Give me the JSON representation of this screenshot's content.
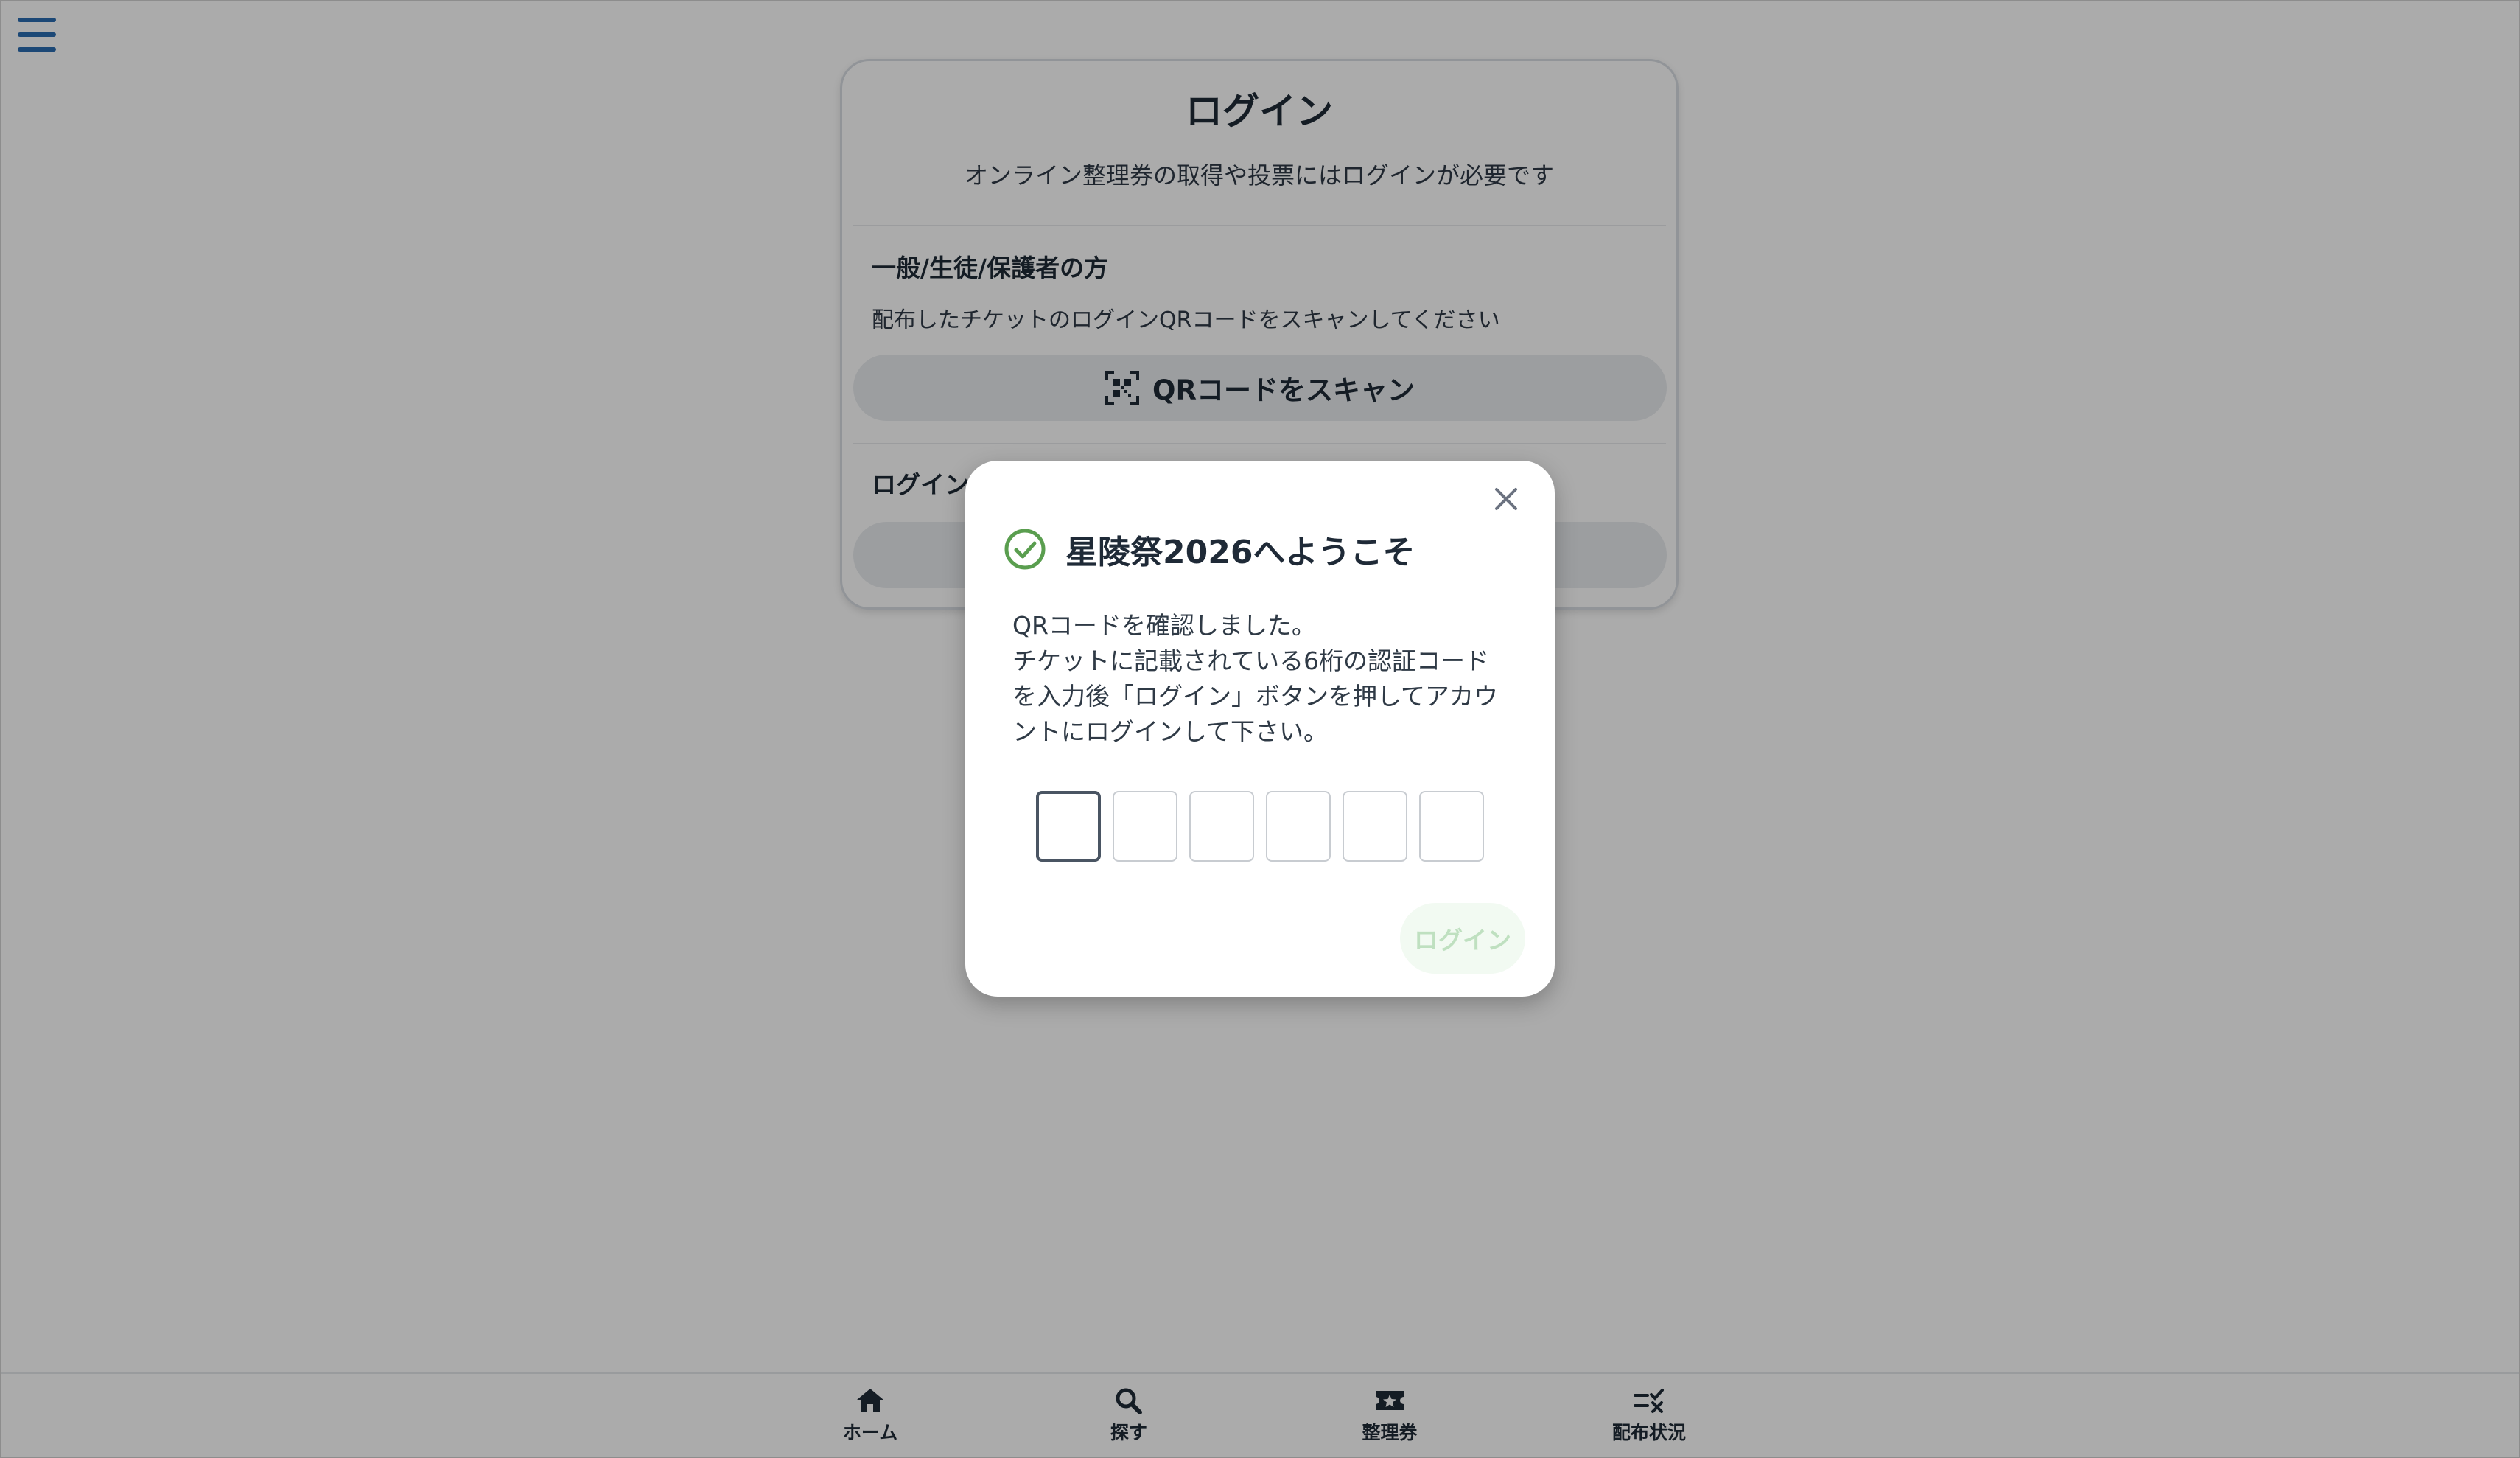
{
  "page": {
    "title": "ログイン",
    "subtitle": "オンライン整理券の取得や投票にはログインが必要です"
  },
  "general_section": {
    "heading": "一般/生徒/保護者の方",
    "description": "配布したチケットのログインQRコードをスキャンしてください",
    "scan_button_label": "QRコードをスキャン",
    "scan_icon": "qr-scan-icon"
  },
  "other_section": {
    "heading_visible": "ログイン"
  },
  "nav": {
    "items": [
      {
        "label": "ホーム",
        "icon": "home-icon"
      },
      {
        "label": "探す",
        "icon": "search-icon"
      },
      {
        "label": "整理券",
        "icon": "ticket-icon"
      },
      {
        "label": "配布状況",
        "icon": "checklist-icon"
      }
    ]
  },
  "dialog": {
    "title": "星陵祭2026へようこそ",
    "icon": "check-circle-icon",
    "message_lines": [
      "QRコードを確認しました。",
      "チケットに記載されている6桁の認証コード",
      "を入力後「ログイン」ボタンを押してアカウ",
      "ントにログインして下さい。"
    ],
    "code_length": 6,
    "code_values": [
      "",
      "",
      "",
      "",
      "",
      ""
    ],
    "login_button_label": "ログイン",
    "close_icon": "close-icon"
  },
  "colors": {
    "menu_icon": "#2b6cb0",
    "success_green": "#5a9e4f",
    "login_button_text": "#bfe0c0",
    "overlay": "rgba(0,0,0,0.33)"
  }
}
